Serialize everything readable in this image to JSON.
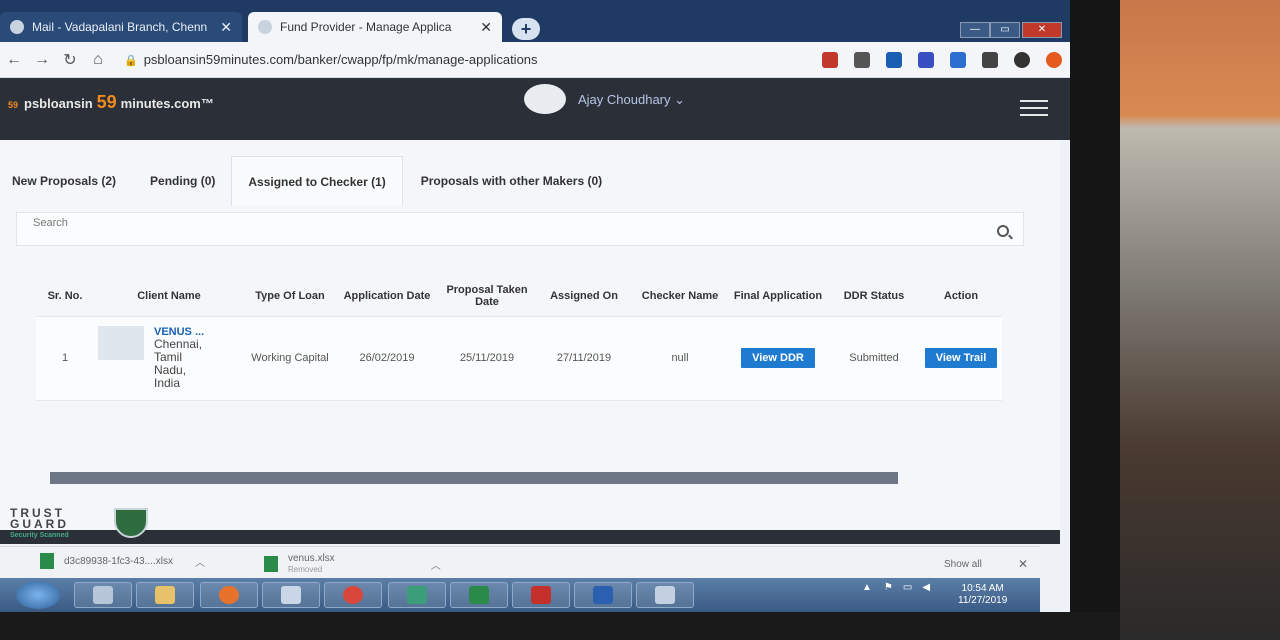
{
  "browser": {
    "tabs": [
      {
        "title": "Mail - Vadapalani Branch, Chenn",
        "close": "✕"
      },
      {
        "title": "Fund Provider - Manage Applica",
        "close": "✕"
      }
    ],
    "new_tab": "+",
    "url": "psbloansin59minutes.com/banker/cwapp/fp/mk/manage-applications"
  },
  "header": {
    "brand_badge": "59",
    "brand_pre": "psbloansin",
    "brand_num": "59",
    "brand_post": "minutes.com™",
    "user": "Ajay Choudhary ⌄"
  },
  "tabs": [
    {
      "label": "New Proposals (2)"
    },
    {
      "label": "Pending (0)"
    },
    {
      "label": "Assigned to Checker (1)"
    },
    {
      "label": "Proposals with other Makers (0)"
    }
  ],
  "search": {
    "label": "Search"
  },
  "table": {
    "headers": [
      "Sr. No.",
      "Client Name",
      "Type Of Loan",
      "Application Date",
      "Proposal Taken Date",
      "Assigned On",
      "Checker Name",
      "Final Application",
      "DDR Status",
      "Action"
    ],
    "rows": [
      {
        "sr": "1",
        "client_name": "VENUS ...",
        "client_addr": "Chennai, Tamil Nadu, India",
        "loan_type": "Working Capital",
        "application_date": "26/02/2019",
        "proposal_taken_date": "25/11/2019",
        "assigned_on": "27/11/2019",
        "checker": "null",
        "final_app_btn": "View DDR",
        "ddr_status": "Submitted",
        "action_btn": "View Trail"
      }
    ]
  },
  "trustguard": {
    "line1": "TRUST",
    "line2": "GUARD",
    "sub": "Security Scanned"
  },
  "downloads": {
    "items": [
      {
        "name": "d3c89938-1fc3-43....xlsx",
        "sub": ""
      },
      {
        "name": "venus.xlsx",
        "sub": "Removed"
      }
    ],
    "show_all": "Show all",
    "close": "✕"
  },
  "taskbar": {
    "time": "10:54 AM",
    "date": "11/27/2019"
  },
  "colors": {
    "accent": "#1f7bd0",
    "header_bg": "#2b2f38",
    "brand_orange": "#f28a1e"
  }
}
